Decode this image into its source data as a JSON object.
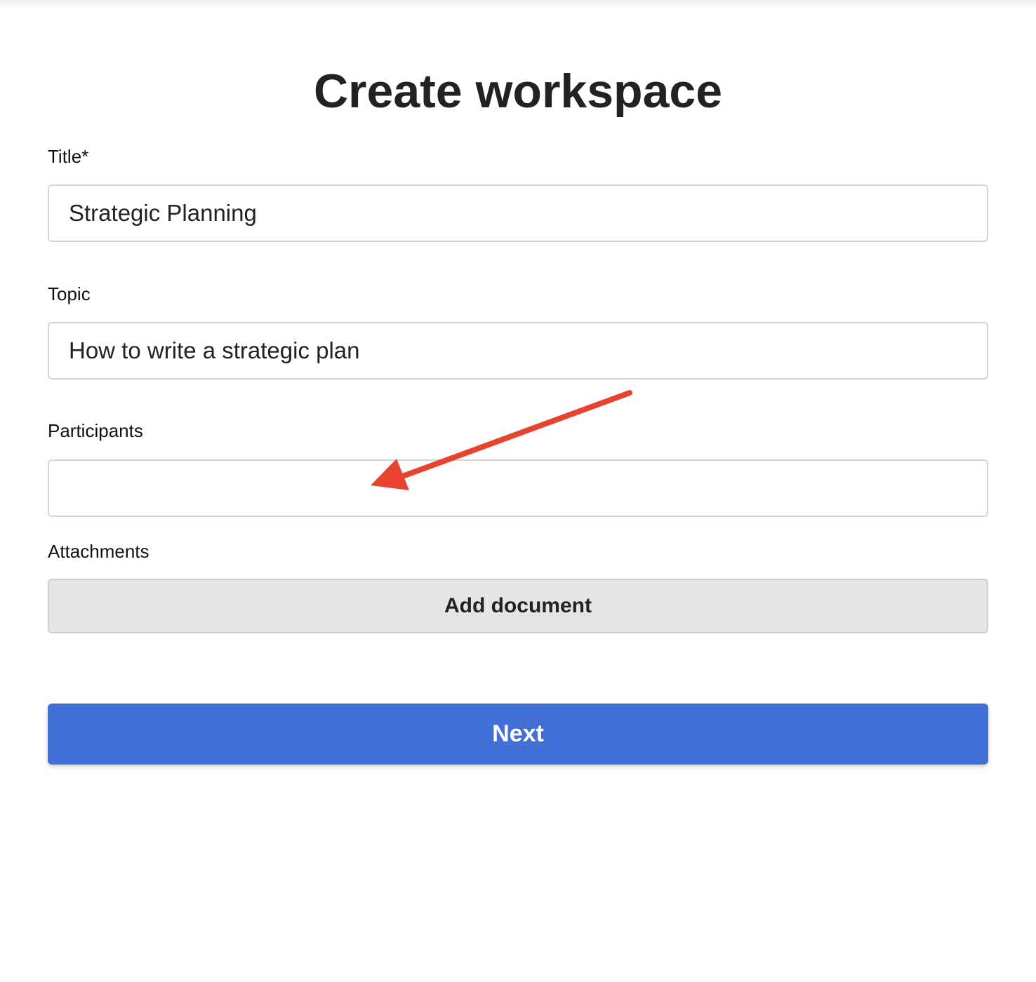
{
  "page": {
    "title": "Create workspace"
  },
  "form": {
    "title_field": {
      "label": "Title*",
      "value": "Strategic Planning"
    },
    "topic_field": {
      "label": "Topic",
      "value": "How to write a strategic plan"
    },
    "participants_field": {
      "label": "Participants",
      "value": ""
    },
    "attachments": {
      "label": "Attachments",
      "add_button_label": "Add document"
    },
    "next_button_label": "Next"
  },
  "annotation": {
    "arrow_color": "#e8432f"
  },
  "colors": {
    "primary": "#4270d6",
    "secondary_button_bg": "#e5e5e5",
    "border": "#d4d4d4"
  }
}
